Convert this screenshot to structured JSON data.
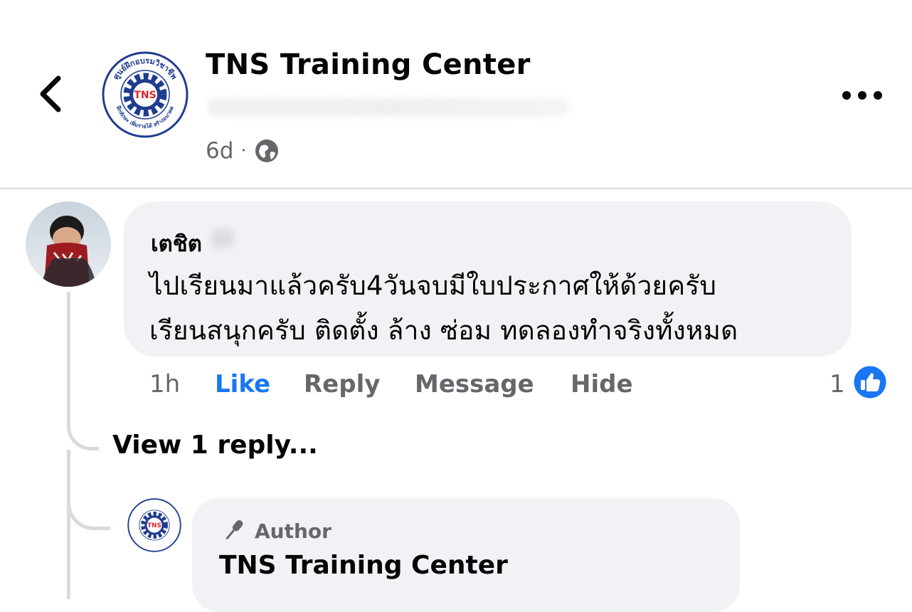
{
  "post": {
    "page_name": "TNS Training Center",
    "logo_text": "TNS",
    "logo_ring_top": "ศูนย์ฝึกอบรมวิชาชีพ",
    "logo_ring_bottom": "ฝึกทักษะ เพิ่มรายได้ สร้างอนาคต",
    "time": "6d",
    "separator": "·",
    "privacy_icon": "globe-icon",
    "more_icon": "more-dots-icon",
    "back_icon": "chevron-left-icon"
  },
  "comment": {
    "author": "เตชิต",
    "text_line1": "ไปเรียนมาแล้วครับ4วันจบมีใบประกาศให้ด้วยครับ",
    "text_line2": "เรียนสนุกครับ ติดตั้ง ล้าง ซ่อม ทดลองทำจริงทั้งหมด",
    "time": "1h",
    "actions": {
      "like": "Like",
      "reply": "Reply",
      "message": "Message",
      "hide": "Hide"
    },
    "reaction_count": "1",
    "reaction_icon": "thumbs-up-icon"
  },
  "replies": {
    "view_label": "View 1 reply..."
  },
  "reply": {
    "badge_icon": "microphone-icon",
    "badge_label": "Author",
    "author": "TNS Training Center"
  },
  "colors": {
    "accent": "#1877f2",
    "secondary_text": "#65676b",
    "bubble": "#f0f2f5",
    "logo_blue": "#1f3d8f",
    "logo_red": "#d6262b"
  }
}
